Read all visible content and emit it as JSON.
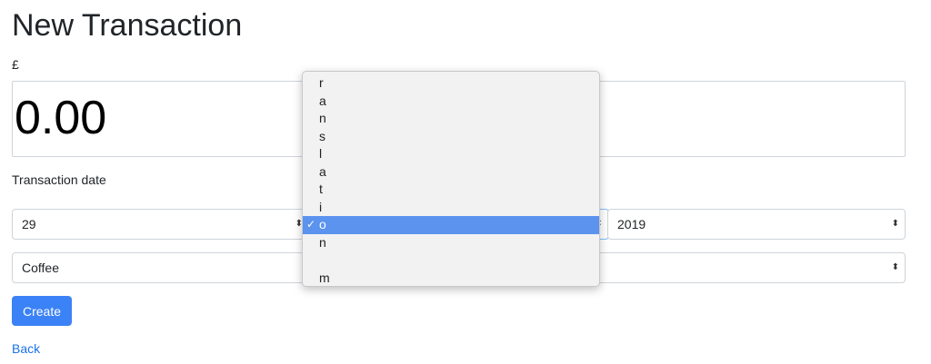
{
  "page": {
    "title": "New Transaction",
    "currency_symbol": "£",
    "amount_value": "0.00",
    "date_label": "Transaction date",
    "create_label": "Create",
    "back_label": "Back"
  },
  "form": {
    "day_value": "29",
    "month_value": "",
    "year_value": "2019",
    "category_value": "Coffee"
  },
  "dropdown": {
    "options": [
      "r",
      "a",
      "n",
      "s",
      "l",
      "a",
      "t",
      "i",
      "o",
      "n",
      "",
      "m"
    ],
    "selected_index": 8,
    "check_glyph": "✓"
  },
  "icons": {
    "select_arrows": "⬍"
  },
  "colors": {
    "primary": "#3b82f6",
    "link": "#1a73e8",
    "dropdown_highlight": "#5b93ee",
    "focus_border": "#80bdff"
  }
}
